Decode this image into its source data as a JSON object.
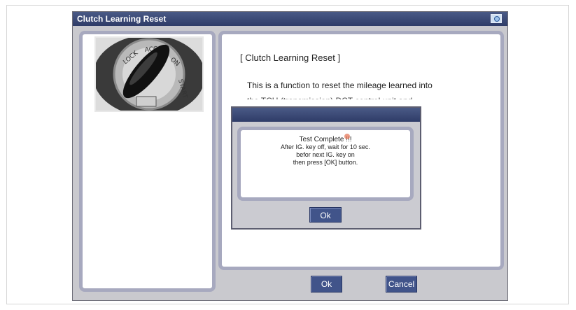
{
  "window": {
    "title": "Clutch Learning Reset",
    "title_icon": "picture-icon"
  },
  "content": {
    "section_title": "[ Clutch Learning Reset ]",
    "description": "This is a function to reset the  mileage learned into",
    "description_cut": "the TCU (transmission) DCT control unit and"
  },
  "buttons": {
    "ok_label": "Ok",
    "cancel_label": "Cancel"
  },
  "dialog": {
    "line1": "Test Complete !!!",
    "line2": "After IG. key off, wait for 10 sec.",
    "line3": "befor next IG. key on",
    "line4": "then press [OK] button.",
    "ok_label": "Ok"
  },
  "colors": {
    "titlebar": "#3b4a78",
    "button": "#41548a",
    "panel_border": "#a7a9bf",
    "window_bg": "#c9c9ce"
  }
}
